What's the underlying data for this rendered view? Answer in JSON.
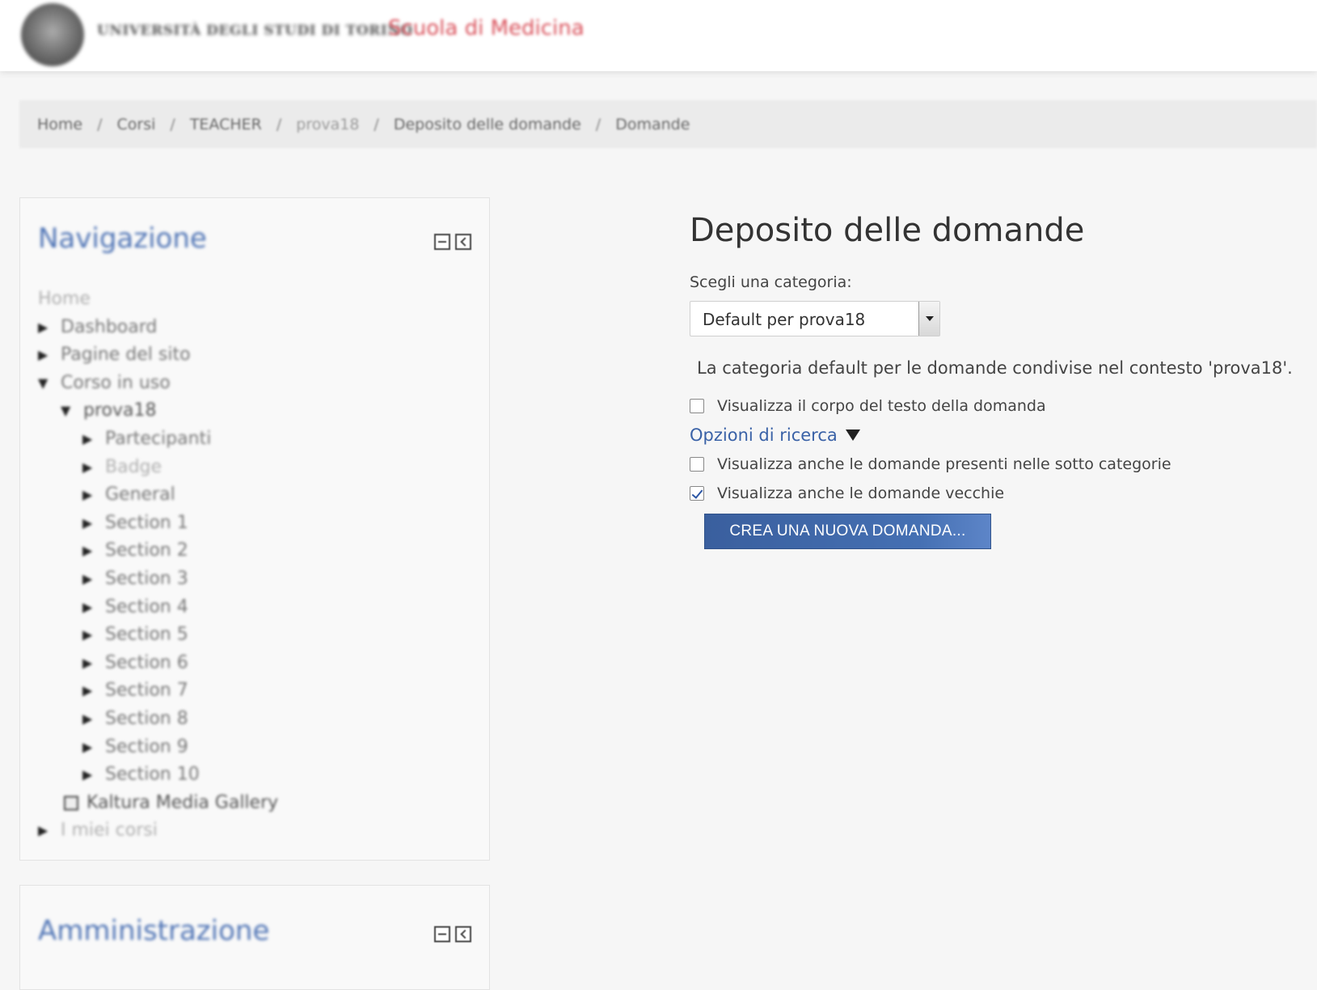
{
  "header": {
    "university_name": "UNIVERSITÀ DEGLI STUDI DI TORINO",
    "school_name": "Scuola di Medicina"
  },
  "breadcrumb": {
    "items": [
      "Home",
      "Corsi",
      "TEACHER",
      "prova18",
      "Deposito delle domande",
      "Domande"
    ],
    "separator": "/"
  },
  "navigation": {
    "title": "Navigazione",
    "items": [
      {
        "label": "Home",
        "arrow": ""
      },
      {
        "label": "Dashboard",
        "arrow": "▶"
      },
      {
        "label": "Pagine del sito",
        "arrow": "▶"
      },
      {
        "label": "Corso in uso",
        "arrow": "▼"
      },
      {
        "label": "prova18",
        "arrow": "▼"
      },
      {
        "label": "Partecipanti",
        "arrow": "▶"
      },
      {
        "label": "Badge",
        "arrow": "▶"
      },
      {
        "label": "General",
        "arrow": "▶"
      },
      {
        "label": "Section 1",
        "arrow": "▶"
      },
      {
        "label": "Section 2",
        "arrow": "▶"
      },
      {
        "label": "Section 3",
        "arrow": "▶"
      },
      {
        "label": "Section 4",
        "arrow": "▶"
      },
      {
        "label": "Section 5",
        "arrow": "▶"
      },
      {
        "label": "Section 6",
        "arrow": "▶"
      },
      {
        "label": "Section 7",
        "arrow": "▶"
      },
      {
        "label": "Section 8",
        "arrow": "▶"
      },
      {
        "label": "Section 9",
        "arrow": "▶"
      },
      {
        "label": "Section 10",
        "arrow": "▶"
      },
      {
        "label": "Kaltura Media Gallery",
        "arrow": ""
      },
      {
        "label": "I miei corsi",
        "arrow": "▶"
      }
    ]
  },
  "administration": {
    "title": "Amministrazione"
  },
  "main": {
    "title": "Deposito delle domande",
    "category_label": "Scegli una categoria:",
    "category_selected": "Default per prova18",
    "category_info": "La categoria default per le domande condivise nel contesto 'prova18'.",
    "show_question_text": {
      "label": "Visualizza il corpo del testo della domanda",
      "checked": false
    },
    "search_options_label": "Opzioni di ricerca",
    "show_subcategories": {
      "label": "Visualizza anche le domande presenti nelle sotto categorie",
      "checked": false
    },
    "show_old": {
      "label": "Visualizza anche le domande vecchie",
      "checked": true
    },
    "create_button": "CREA UNA NUOVA DOMANDA..."
  },
  "colors": {
    "accent_blue": "#3a62a7",
    "button_blue": "#4570b3",
    "school_red": "#d9505a",
    "nav_title_blue": "#4f74b5"
  }
}
